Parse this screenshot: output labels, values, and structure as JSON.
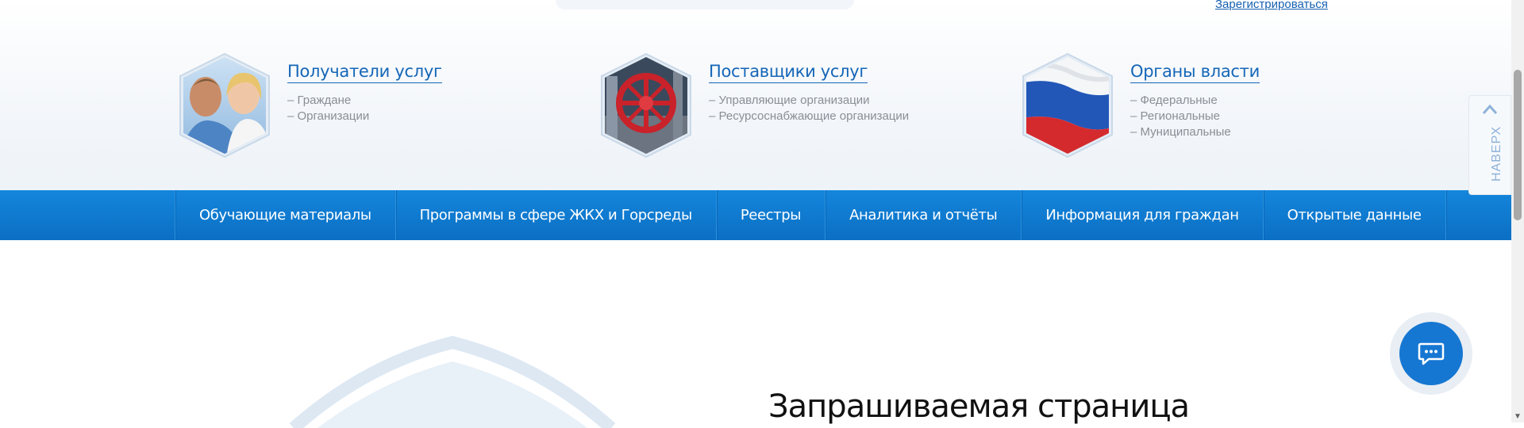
{
  "header": {
    "register_link": "Зарегистрироваться"
  },
  "categories": [
    {
      "title": "Получатели услуг",
      "icon": "people-photo",
      "items": [
        "– Граждане",
        "– Организации"
      ]
    },
    {
      "title": "Поставщики услуг",
      "icon": "valve-photo",
      "items": [
        "– Управляющие организации",
        "– Ресурсоснабжающие организации"
      ]
    },
    {
      "title": "Органы власти",
      "icon": "russian-flag-photo",
      "items": [
        "– Федеральные",
        "– Региональные",
        "– Муниципальные"
      ]
    }
  ],
  "nav": {
    "items": [
      "Обучающие материалы",
      "Программы в сфере ЖКХ и Горсреды",
      "Реестры",
      "Аналитика и отчёты",
      "Информация для граждан",
      "Открытые данные"
    ]
  },
  "to_top": {
    "label": "НАВЕРХ"
  },
  "chat": {
    "icon": "chat-icon"
  },
  "main": {
    "heading": "Запрашиваемая страница"
  },
  "colors": {
    "brand_blue": "#1566b7",
    "nav_bg": "#0b7bd2",
    "chat_bg": "#1677d2",
    "muted_text": "#8a8f96"
  }
}
